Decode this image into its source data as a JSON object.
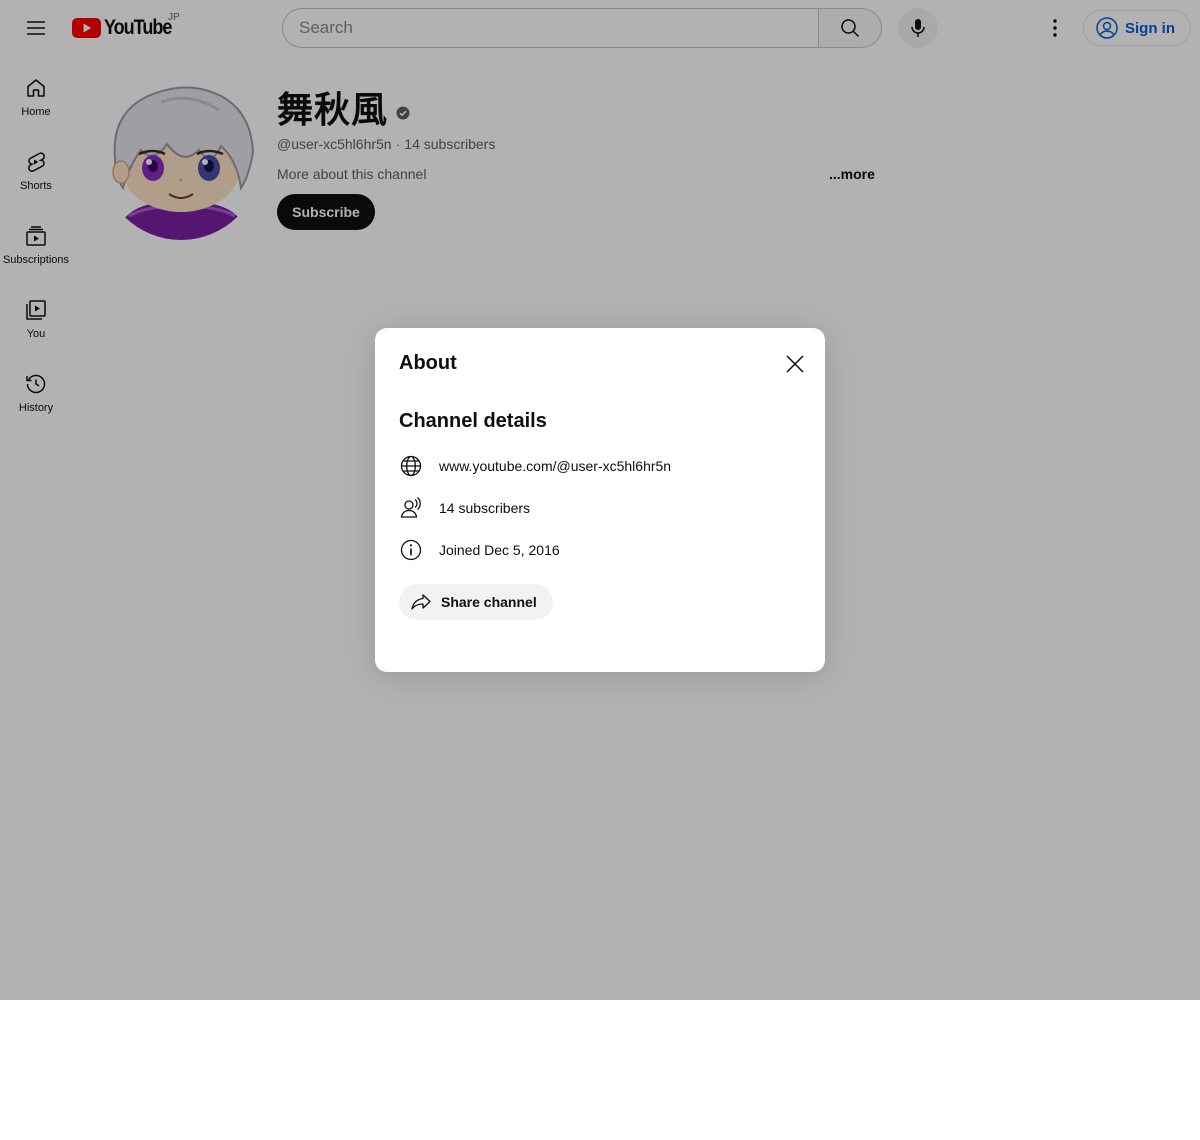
{
  "header": {
    "logo_text": "YouTube",
    "country_code": "JP",
    "search_placeholder": "Search",
    "signin_label": "Sign in"
  },
  "sidebar": {
    "items": [
      {
        "label": "Home",
        "icon": "home-icon"
      },
      {
        "label": "Shorts",
        "icon": "shorts-icon"
      },
      {
        "label": "Subscriptions",
        "icon": "subscriptions-icon"
      },
      {
        "label": "You",
        "icon": "you-icon"
      },
      {
        "label": "History",
        "icon": "history-icon"
      }
    ]
  },
  "channel": {
    "name": "舞秋風",
    "handle": "@user-xc5hl6hr5n",
    "separator": "·",
    "subscribers": "14 subscribers",
    "description": "More about this channel",
    "more_label": "...more",
    "subscribe_label": "Subscribe"
  },
  "about_dialog": {
    "title": "About",
    "section_title": "Channel details",
    "details": [
      {
        "icon": "globe-icon",
        "text": "www.youtube.com/@user-xc5hl6hr5n"
      },
      {
        "icon": "subscribers-icon",
        "text": "14 subscribers"
      },
      {
        "icon": "info-icon",
        "text": "Joined Dec 5, 2016"
      }
    ],
    "share_label": "Share channel"
  },
  "colors": {
    "brand_red": "#ff0000",
    "link_blue": "#065fd4",
    "scrim": "rgba(0,0,0,0.30)"
  }
}
